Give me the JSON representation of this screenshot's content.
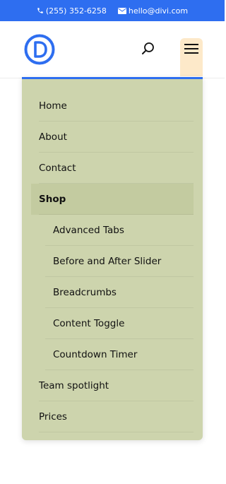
{
  "topbar": {
    "phone": "(255) 352-6258",
    "email": "hello@divi.com",
    "phone_icon": "phone-icon",
    "email_icon": "envelope-icon",
    "background_color": "#2e6ef0"
  },
  "header": {
    "logo_icon": "divi-logo-icon",
    "search_icon": "search-icon",
    "menu_icon": "hamburger-icon"
  },
  "menu": {
    "accent_color": "#2e6ef0",
    "background_color": "#cdd4ad",
    "items": [
      {
        "label": "Home"
      },
      {
        "label": "About"
      },
      {
        "label": "Contact"
      },
      {
        "label": "Shop"
      },
      {
        "label": "Advanced Tabs"
      },
      {
        "label": "Before and After Slider"
      },
      {
        "label": "Breadcrumbs"
      },
      {
        "label": "Content Toggle"
      },
      {
        "label": "Countdown Timer"
      },
      {
        "label": "Team spotlight"
      },
      {
        "label": "Prices"
      }
    ]
  }
}
